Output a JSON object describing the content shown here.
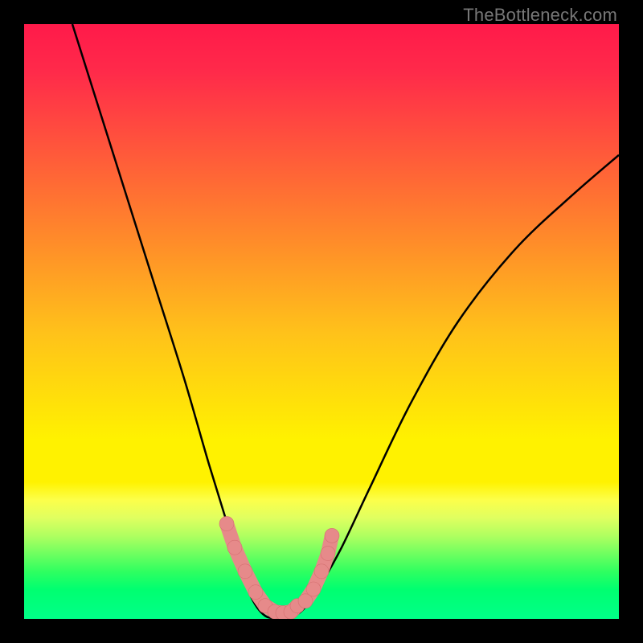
{
  "watermark": "TheBottleneck.com",
  "chart_data": {
    "type": "line",
    "title": "",
    "xlabel": "",
    "ylabel": "",
    "xlim": [
      0,
      740
    ],
    "ylim": [
      0,
      100
    ],
    "curve": {
      "name": "bottleneck-curve",
      "x": [
        60,
        95,
        130,
        165,
        200,
        230,
        255,
        270,
        285,
        300,
        315,
        335,
        350,
        370,
        395,
        430,
        480,
        540,
        610,
        680,
        740
      ],
      "y": [
        100,
        85,
        70,
        55,
        40,
        26,
        15,
        8,
        3,
        0.5,
        0.2,
        0.5,
        2,
        6,
        12,
        22,
        36,
        50,
        62,
        71,
        78
      ]
    },
    "markers_left": {
      "x": [
        252,
        262,
        275,
        288,
        300,
        312,
        322,
        332,
        340
      ],
      "y": [
        16,
        12,
        8,
        4.5,
        2.2,
        1.2,
        1.0,
        1.2,
        2.2
      ]
    },
    "markers_right": {
      "x": [
        350,
        360,
        370,
        378,
        383
      ],
      "y": [
        3.0,
        5.0,
        8.0,
        11.0,
        14.0
      ]
    },
    "colors": {
      "curve": "#000000",
      "marker_fill": "#e68a8a",
      "marker_stroke": "#d47070"
    }
  }
}
